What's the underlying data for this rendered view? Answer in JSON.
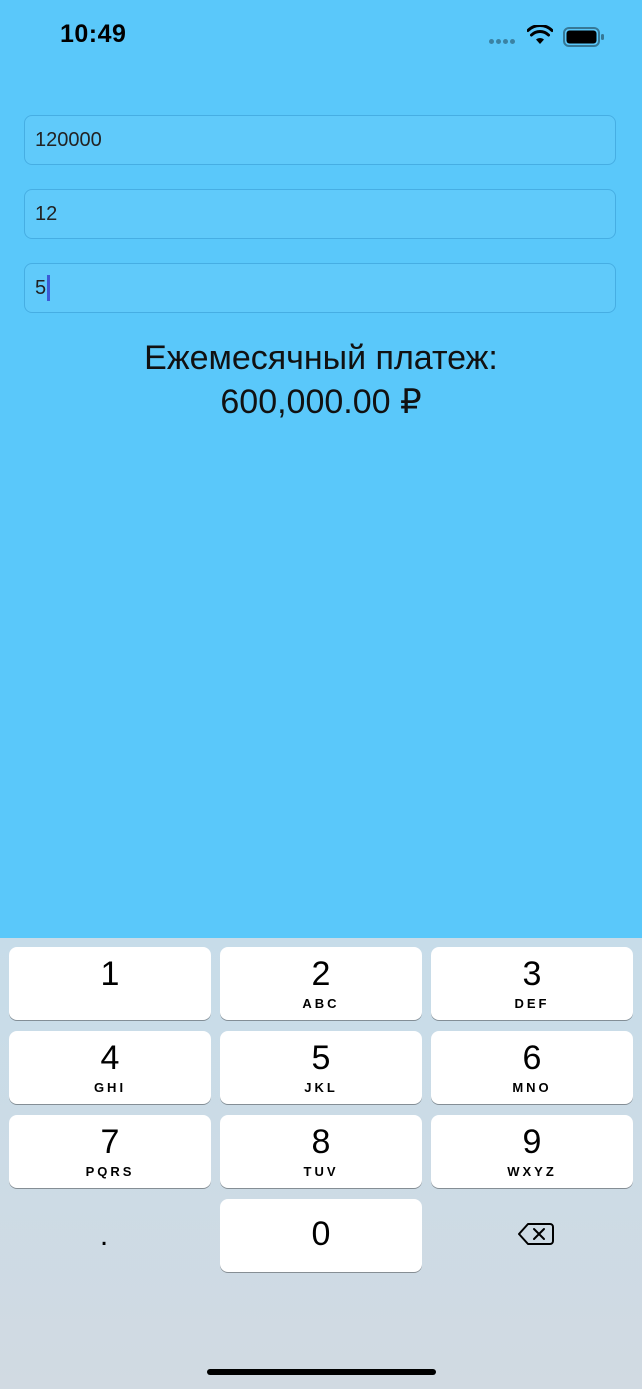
{
  "status_bar": {
    "time": "10:49",
    "icons": [
      "cellular-signal-icon",
      "wifi-icon",
      "battery-icon"
    ]
  },
  "form": {
    "amount_value": "120000",
    "term_value": "12",
    "rate_value": "5"
  },
  "result": {
    "label": "Ежемесячный платеж:",
    "value": "600,000.00 ₽"
  },
  "keyboard": {
    "keys": [
      {
        "digit": "1",
        "letters": ""
      },
      {
        "digit": "2",
        "letters": "ABC"
      },
      {
        "digit": "3",
        "letters": "DEF"
      },
      {
        "digit": "4",
        "letters": "GHI"
      },
      {
        "digit": "5",
        "letters": "JKL"
      },
      {
        "digit": "6",
        "letters": "MNO"
      },
      {
        "digit": "7",
        "letters": "PQRS"
      },
      {
        "digit": "8",
        "letters": "TUV"
      },
      {
        "digit": "9",
        "letters": "WXYZ"
      }
    ],
    "decimal": ".",
    "zero": "0",
    "delete_icon": "delete-backspace-icon"
  },
  "colors": {
    "background": "#5AC8FA",
    "keyboard_background": "#D1DAE2",
    "cursor": "#3B5BD6"
  }
}
